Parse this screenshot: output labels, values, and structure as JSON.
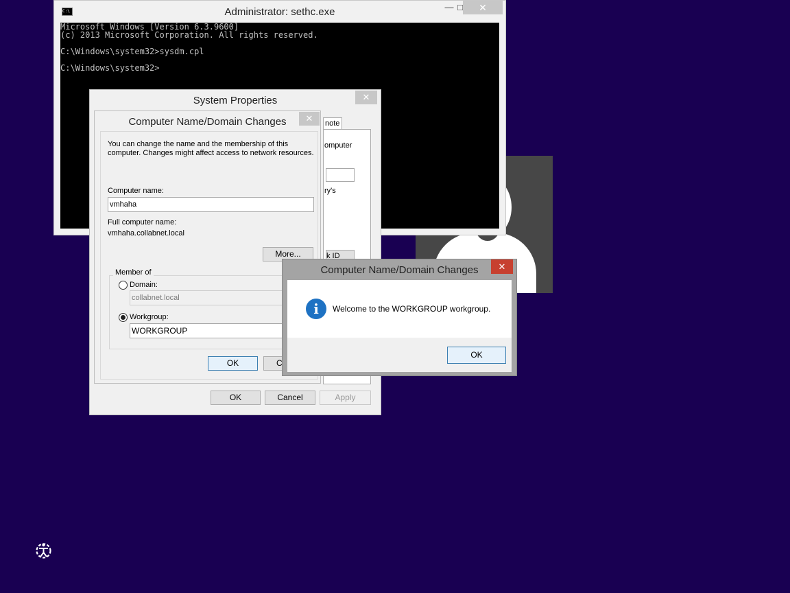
{
  "cmd": {
    "title": "Administrator: sethc.exe",
    "icon": "cmd-icon",
    "minimize_glyph": "—",
    "maximize_glyph": "□",
    "close_glyph": "✕",
    "lines": [
      "Microsoft Windows [Version 6.3.9600]",
      "(c) 2013 Microsoft Corporation. All rights reserved.",
      "",
      "C:\\Windows\\system32>sysdm.cpl",
      "",
      "C:\\Windows\\system32>"
    ]
  },
  "sysprops": {
    "title": "System Properties",
    "close_glyph": "✕",
    "tab_fragment": "note",
    "frag_computer": "omputer",
    "frag_rys": "ry's",
    "frag_button": "k ID",
    "ok": "OK",
    "cancel": "Cancel",
    "apply": "Apply"
  },
  "namechange": {
    "title": "Computer Name/Domain Changes",
    "close_glyph": "✕",
    "desc_line1": "You can change the name and the membership of this",
    "desc_line2": "computer. Changes might affect access to network resources.",
    "computer_name_label": "Computer name:",
    "computer_name_value": "vmhaha",
    "full_name_label": "Full computer name:",
    "full_name_value": "vmhaha.collabnet.local",
    "more_button": "More...",
    "member_of_label": "Member of",
    "domain_label": "Domain:",
    "domain_value": "collabnet.local",
    "workgroup_label": "Workgroup:",
    "workgroup_value": "WORKGROUP",
    "ok": "OK",
    "cancel_fragment": "C"
  },
  "welcome": {
    "title": "Computer Name/Domain Changes",
    "close_glyph": "✕",
    "icon": "info-icon",
    "info_glyph": "i",
    "message": "Welcome to the WORKGROUP workgroup.",
    "ok": "OK"
  },
  "desktop": {
    "background_color": "#190052",
    "ease_of_access_icon": "ease-of-access-icon",
    "user_tile_icon": "user-avatar-icon"
  }
}
